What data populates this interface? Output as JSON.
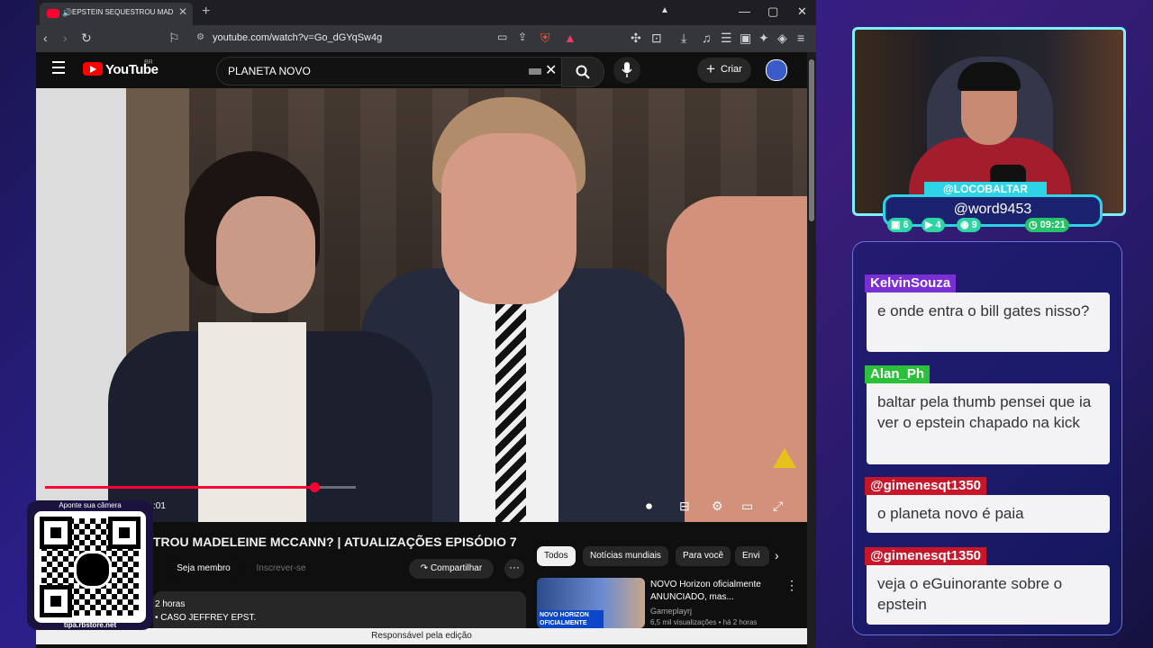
{
  "browser": {
    "tab_title": "EPSTEIN SEQUESTROU MADELEINE",
    "url": "youtube.com/watch?v=Go_dGYqSw4g",
    "status_text": "Responsável pela edição"
  },
  "youtube": {
    "logo_text": "YouTube",
    "region": "BR",
    "search_value": "PLANETA NOVO",
    "create_label": "Criar",
    "video_time": ":01",
    "video_progress": 0.87,
    "video_title": "TROU MADELEINE MCCANN? | ATUALIZAÇÕES EPISÓDIO 7",
    "member_label": "Seja membro",
    "subscribe_label": "Inscrever-se",
    "share_label": "Compartilhar",
    "description_line1": "2 horas",
    "description_line2": "• CASO JEFFREY EPST.",
    "chips": [
      "Todos",
      "Notícias mundiais",
      "Para você",
      "Envi"
    ],
    "recommended": {
      "title": "NOVO Horizon oficialmente ANUNCIADO, mas...",
      "channel": "Gameplayrj",
      "meta": "6,5 mil visualizações • há 2 horas",
      "thumb_text": "NOVO HORIZON OFICIALMENTE"
    }
  },
  "qr_widget": {
    "top_text": "Aponte sua câmera",
    "bottom_text": "tipa.rbstore.net"
  },
  "stream": {
    "channel_name": "@LOCOBALTAR",
    "tag": "@word9453",
    "stats": [
      "6",
      "4",
      "9",
      "09:21"
    ],
    "accent": "#2dd4e6"
  },
  "chat": [
    {
      "user": "KelvinSouza",
      "color": "#7a2fd4",
      "text": "e onde entra o bill gates nisso?"
    },
    {
      "user": "Alan_Ph",
      "color": "#2bbf3a",
      "text": "baltar pela thumb pensei que ia ver o epstein chapado na kick"
    },
    {
      "user": "@gimenesqt1350",
      "color": "#c8152a",
      "text": "o planeta novo é paia"
    },
    {
      "user": "@gimenesqt1350",
      "color": "#c8152a",
      "text": "veja o eGuinorante sobre o epstein"
    }
  ]
}
